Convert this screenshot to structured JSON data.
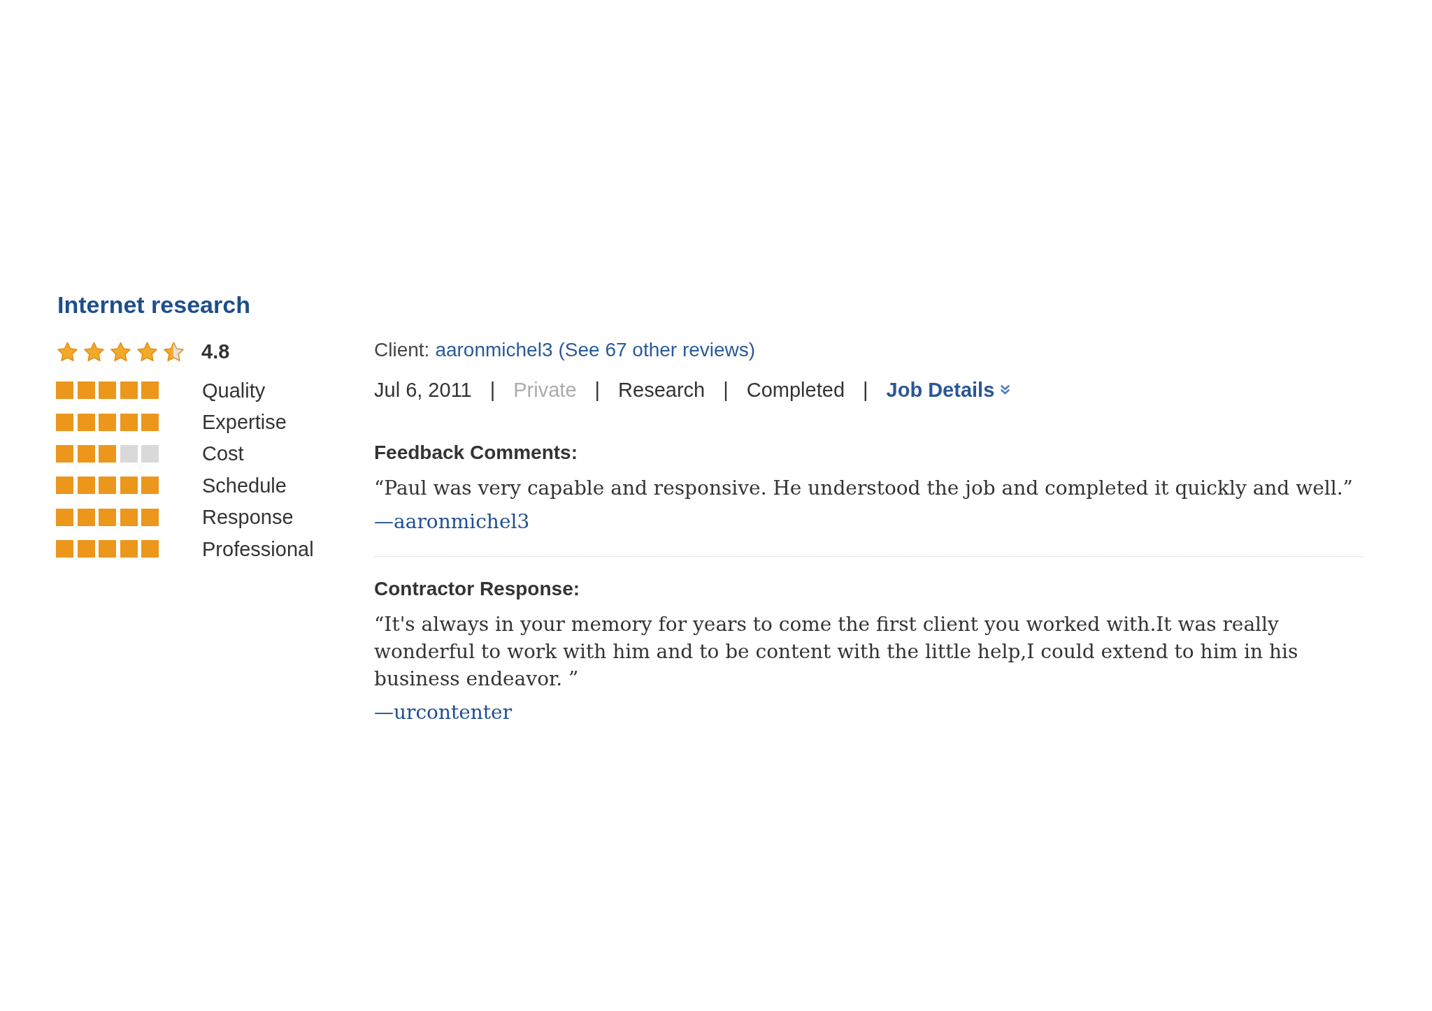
{
  "title": "Internet research",
  "rating": {
    "stars": 4.5,
    "score": "4.8"
  },
  "criteria": [
    {
      "label": "Quality",
      "stars": 5
    },
    {
      "label": "Expertise",
      "stars": 5
    },
    {
      "label": "Cost",
      "stars": 3
    },
    {
      "label": "Schedule",
      "stars": 5
    },
    {
      "label": "Response",
      "stars": 5
    },
    {
      "label": "Professional",
      "stars": 5
    }
  ],
  "client": {
    "label": "Client:",
    "name": "aaronmichel3",
    "reviews_link": "(See 67 other reviews)"
  },
  "meta": [
    {
      "kind": "date",
      "text": "Jul 6, 2011"
    },
    {
      "kind": "separator",
      "text": "|"
    },
    {
      "kind": "private",
      "text": "Private"
    },
    {
      "kind": "separator",
      "text": "|"
    },
    {
      "kind": "category",
      "text": "Research"
    },
    {
      "kind": "separator",
      "text": "|"
    },
    {
      "kind": "status",
      "text": "Completed"
    },
    {
      "kind": "separator",
      "text": "|"
    },
    {
      "kind": "link",
      "text": "Job Details"
    }
  ],
  "feedback": {
    "heading": "Feedback Comments:",
    "quote": "“Paul was very capable and responsive. He understood the job and completed it quickly and well.”",
    "author": "—aaronmichel3"
  },
  "response": {
    "heading": "Contractor Response:",
    "quote": "“It's always in your memory for years to come the first client you worked with.It was really wonderful to work with him and to be content with the little help,I could extend to him in his business endeavor. ”",
    "author": "—urcontenter"
  }
}
